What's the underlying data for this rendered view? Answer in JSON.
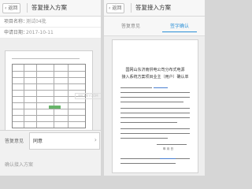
{
  "left": {
    "nav": {
      "back": "返回",
      "title": "答复接入方案"
    },
    "fields": [
      {
        "label": "项目名称：",
        "value": "测试04批"
      },
      {
        "label": "申请日期：",
        "value": "2017-10-11"
      }
    ],
    "preview": {
      "watermark": "MICHEY.COM"
    },
    "sheet": {
      "label": "答复意见",
      "option": "同意",
      "note": "确认接入方案"
    }
  },
  "right": {
    "nav": {
      "back": "返回",
      "title": "答复接入方案"
    },
    "tabs": [
      "答复意见",
      "签字确认"
    ],
    "doc": {
      "heading1": "国网山东济南供电公司分布式电源",
      "heading2": "接入系统方案项目业主（用户）确认单",
      "date": "年  月  日"
    },
    "colors": {
      "tab_active": "#2a8fd6",
      "accent_line": "#4a7fd0"
    }
  }
}
